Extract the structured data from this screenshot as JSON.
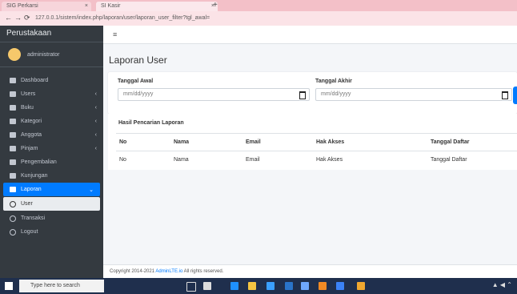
{
  "browser": {
    "tab1": "SIG Perkarsi",
    "tab2": "SI Kasir",
    "url": "127.0.0.1/sistem/index.php/laporan/user/laporan_user_filter?tgl_awal="
  },
  "sidebar": {
    "brand": "Perustakaan",
    "user_name": "administrator",
    "items": [
      {
        "label": "Dashboard"
      },
      {
        "label": "Users"
      },
      {
        "label": "Buku"
      },
      {
        "label": "Kategori"
      },
      {
        "label": "Anggota"
      },
      {
        "label": "Pinjam"
      },
      {
        "label": "Pengembalian"
      },
      {
        "label": "Kunjungan"
      },
      {
        "label": "Laporan"
      }
    ],
    "sub_items": [
      {
        "label": "User"
      },
      {
        "label": "Transaksi"
      },
      {
        "label": "Logout"
      }
    ]
  },
  "page": {
    "title": "Laporan User",
    "tanggal_awal_label": "Tanggal Awal",
    "tanggal_awal_placeholder": "mm/dd/yyyy",
    "tanggal_akhir_label": "Tanggal Akhir",
    "tanggal_akhir_placeholder": "mm/dd/yyyy",
    "result_title": "Hasil Pencarian Laporan"
  },
  "table": {
    "headers": [
      "No",
      "Nama",
      "Email",
      "Hak Akses",
      "Tanggal Daftar"
    ],
    "row": [
      "No",
      "Nama",
      "Email",
      "Hak Akses",
      "Tanggal Daftar"
    ]
  },
  "footer": {
    "text": "Copyright 2014-2021",
    "link": "AdminLTE.io",
    "rest": "All rights reserved."
  },
  "taskbar": {
    "search_placeholder": "Type here to search"
  },
  "colors": {
    "sidebar_bg": "#343a40",
    "accent": "#007bff",
    "tabbar": "#f3c0c8"
  }
}
